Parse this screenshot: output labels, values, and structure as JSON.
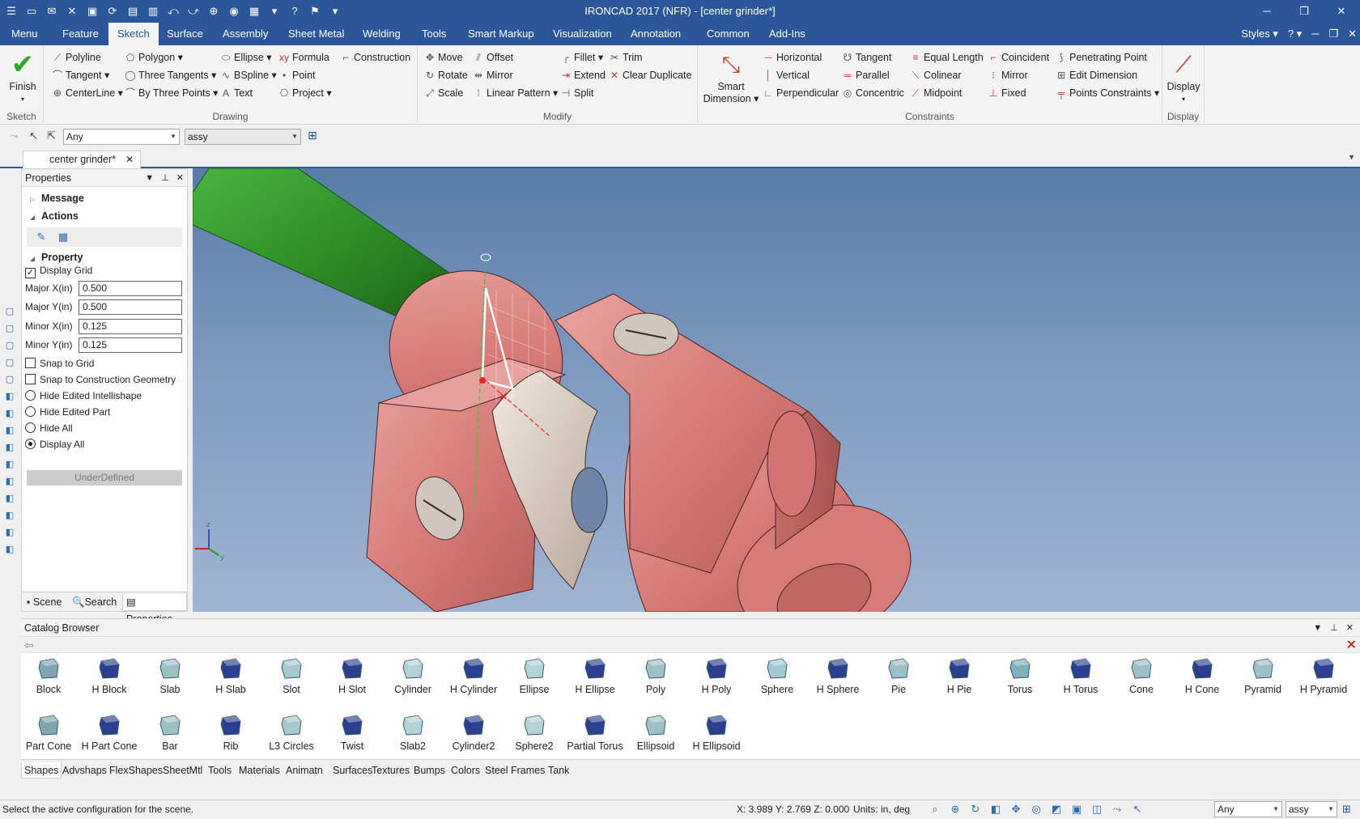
{
  "titlebar": {
    "title": "IRONCAD 2017 (NFR) - [center grinder*]",
    "quick_access": [
      "☰",
      "▭",
      "✉",
      "✕",
      "▣",
      "⟳",
      "▤",
      "▥",
      "⤺",
      "⤻",
      "⊕",
      "◉",
      "▦",
      "▾",
      "?",
      "⚑",
      "▾"
    ],
    "controls": {
      "minimize": "─",
      "maximize": "❐",
      "close": "✕"
    }
  },
  "menubar": {
    "tabs": [
      "Menu",
      "Feature",
      "Sketch",
      "Surface",
      "Assembly",
      "Sheet Metal",
      "Welding",
      "Tools",
      "Smart Markup",
      "Visualization",
      "Annotation",
      "Common",
      "Add-Ins"
    ],
    "active": "Sketch",
    "right": {
      "styles": "Styles ▾",
      "help": "? ▾",
      "min": "─",
      "restore": "❐",
      "close": "✕"
    }
  },
  "ribbon": {
    "sketch": {
      "title": "Sketch",
      "finish": "Finish"
    },
    "drawing": {
      "title": "Drawing",
      "col1": [
        "Polyline",
        "Tangent ▾",
        "CenterLine ▾"
      ],
      "col2": [
        "Polygon ▾",
        "Three Tangents ▾",
        "By Three Points ▾"
      ],
      "col3": [
        "Ellipse ▾",
        "BSpline ▾",
        "Text"
      ],
      "col4": [
        "Formula",
        "Point",
        "Project ▾"
      ],
      "col5": [
        "Construction"
      ]
    },
    "modify": {
      "title": "Modify",
      "col1": [
        "Move",
        "Rotate",
        "Scale"
      ],
      "col2": [
        "Offset",
        "Mirror",
        "Linear Pattern ▾"
      ],
      "col3": [
        "Fillet ▾",
        "Extend",
        "Split"
      ],
      "col4": [
        "Trim",
        "Clear Duplicate"
      ]
    },
    "constraints": {
      "title": "Constraints",
      "smart": "Smart Dimension ▾",
      "col1": [
        "Horizontal",
        "Vertical",
        "Perpendicular"
      ],
      "col2": [
        "Tangent",
        "Parallel",
        "Concentric"
      ],
      "col3": [
        "Equal Length",
        "Colinear",
        "Midpoint"
      ],
      "col4": [
        "Coincident",
        "Mirror",
        "Fixed"
      ],
      "col5": [
        "Penetrating Point",
        "Edit Dimension",
        "Points Constraints ▾"
      ]
    },
    "display": {
      "title": "Display",
      "label": "Display"
    }
  },
  "selection_toolbar": {
    "filter": "Any",
    "config": "assy"
  },
  "document_tab": {
    "label": "center grinder*"
  },
  "properties": {
    "title": "Properties",
    "sections": {
      "message": "Message",
      "actions": "Actions",
      "property": "Property"
    },
    "display_grid": "Display Grid",
    "major_x": {
      "label": "Major X(in)",
      "value": "0.500"
    },
    "major_y": {
      "label": "Major Y(in)",
      "value": "0.500"
    },
    "minor_x": {
      "label": "Minor X(in)",
      "value": "0.125"
    },
    "minor_y": {
      "label": "Minor Y(in)",
      "value": "0.125"
    },
    "snap_grid": "Snap to Grid",
    "snap_construction": "Snap to Construction Geometry",
    "hide_edited_intellishape": "Hide Edited Intellishape",
    "hide_edited_part": "Hide Edited Part",
    "hide_all": "Hide All",
    "display_all": "Display All",
    "status": "UnderDefined",
    "tabs": {
      "scene": "Scene",
      "search": "Search",
      "properties": "Properties"
    }
  },
  "viewport": {
    "axes": {
      "x": "x",
      "y": "y",
      "z": "z"
    }
  },
  "catalog": {
    "title": "Catalog Browser",
    "row1": [
      "Block",
      "H Block",
      "Slab",
      "H Slab",
      "Slot",
      "H Slot",
      "Cylinder",
      "H Cylinder",
      "Ellipse",
      "H Ellipse",
      "Poly",
      "H Poly",
      "Sphere",
      "H Sphere",
      "Pie",
      "H Pie",
      "Torus",
      "H Torus",
      "Cone",
      "H Cone",
      "Pyramid",
      "H Pyramid"
    ],
    "row2": [
      "Part Cone",
      "H Part Cone",
      "Bar",
      "Rib",
      "L3 Circles",
      "Twist",
      "Slab2",
      "Cylinder2",
      "Sphere2",
      "Partial Torus",
      "Ellipsoid",
      "H Ellipsoid"
    ],
    "tabs": [
      "Shapes",
      "Advshaps",
      "FlexShapes",
      "SheetMtl",
      "Tools",
      "Materials",
      "Animatn",
      "Surfaces",
      "Textures",
      "Bumps",
      "Colors",
      "Steel Frames",
      "Tank"
    ],
    "active_tab": "Shapes"
  },
  "statusbar": {
    "message": "Select the active configuration for the scene.",
    "coords": "X: 3.989 Y: 2.769 Z: 0.000",
    "units": "Units: in, deg",
    "filter": "Any",
    "config": "assy"
  },
  "colors": {
    "accent": "#2b579a",
    "part": "#d77b78",
    "shaft": "#2f8a2a",
    "sky_top": "#5a7ba8"
  }
}
